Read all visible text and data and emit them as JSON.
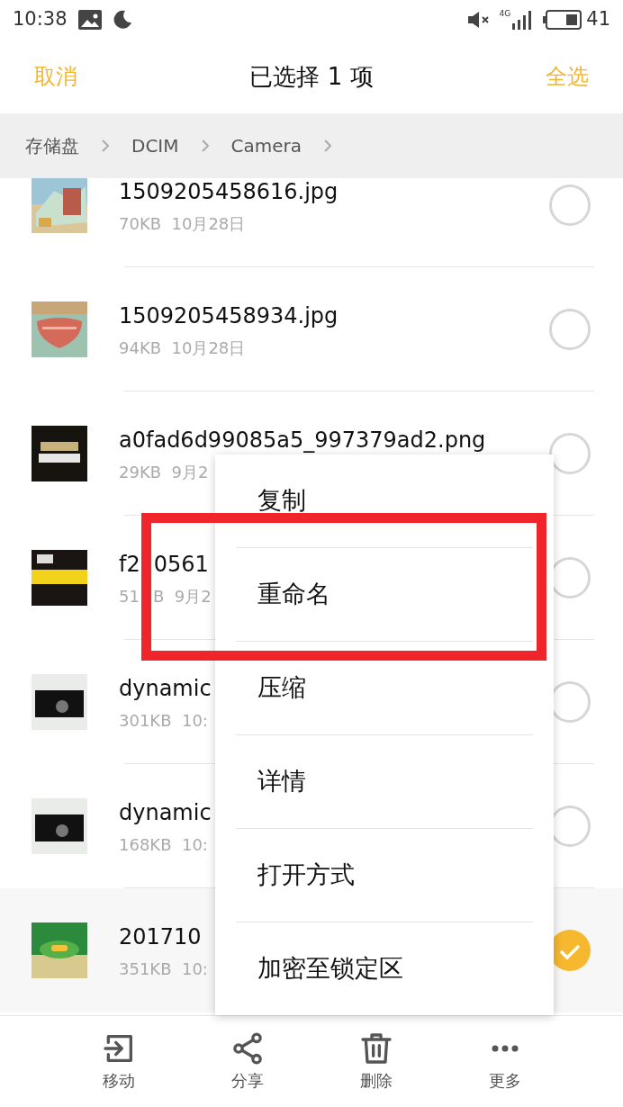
{
  "status_bar": {
    "time": "10:38",
    "network": "4G",
    "battery": "41"
  },
  "header": {
    "cancel": "取消",
    "title": "已选择 1 项",
    "select_all": "全选"
  },
  "breadcrumb": [
    "存储盘",
    "DCIM",
    "Camera"
  ],
  "files": [
    {
      "name": "1509205458616.jpg",
      "meta": "70KB  10月28日",
      "selected": false
    },
    {
      "name": "1509205458934.jpg",
      "meta": "94KB  10月28日",
      "selected": false
    },
    {
      "name": "a0fad6d99085a5_997379ad2.png",
      "meta": "29KB  9月2",
      "selected": false
    },
    {
      "name": "f2",
      "name_tail": "0561",
      "meta": "51",
      "meta_tail": "B  9月2",
      "selected": false
    },
    {
      "name": "dynamic",
      "meta": "301KB  10:",
      "selected": false
    },
    {
      "name": "dynamic",
      "meta": "168KB  10:",
      "selected": false
    },
    {
      "name": "201710",
      "meta": "351KB  10:",
      "selected": true
    }
  ],
  "menu": [
    "复制",
    "重命名",
    "压缩",
    "详情",
    "打开方式",
    "加密至锁定区"
  ],
  "actions": [
    {
      "kind": "move",
      "label": "移动"
    },
    {
      "kind": "share",
      "label": "分享"
    },
    {
      "kind": "delete",
      "label": "删除"
    },
    {
      "kind": "more",
      "label": "更多"
    }
  ]
}
